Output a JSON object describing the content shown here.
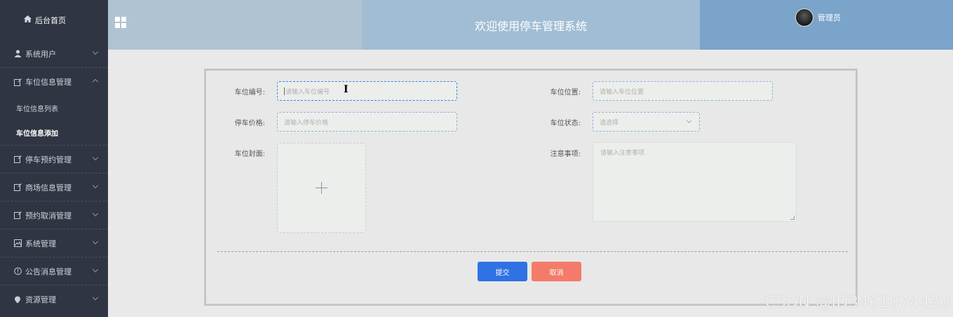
{
  "sidebar": {
    "home_label": "后台首页",
    "items": [
      {
        "label": "系统用户"
      },
      {
        "label": "车位信息管理"
      },
      {
        "label": "停车预约管理"
      },
      {
        "label": "商场信息管理"
      },
      {
        "label": "预约取消管理"
      },
      {
        "label": "系统管理"
      },
      {
        "label": "公告消息管理"
      },
      {
        "label": "资源管理"
      }
    ],
    "sub_items": [
      {
        "label": "车位信息列表"
      },
      {
        "label": "车位信息添加"
      }
    ]
  },
  "header": {
    "title": "欢迎使用停车管理系统",
    "user": "管理员"
  },
  "form": {
    "spot_no": {
      "label": "车位编号:",
      "placeholder": "请输入车位编号"
    },
    "spot_location": {
      "label": "车位位置:",
      "placeholder": "请输入车位位置"
    },
    "price": {
      "label": "停车价格:",
      "placeholder": "请输入停车价格"
    },
    "status": {
      "label": "车位状态:",
      "placeholder": "请选择"
    },
    "cover": {
      "label": "车位封面:"
    },
    "notes": {
      "label": "注意事项:",
      "placeholder": "请输入注意事项"
    },
    "submit_label": "提交",
    "cancel_label": "取消"
  },
  "watermark": "CSDN @ID3461074420",
  "colors": {
    "sidebar_bg": "#2f3542",
    "submit": "#2f72e3",
    "cancel": "#f47b69"
  }
}
